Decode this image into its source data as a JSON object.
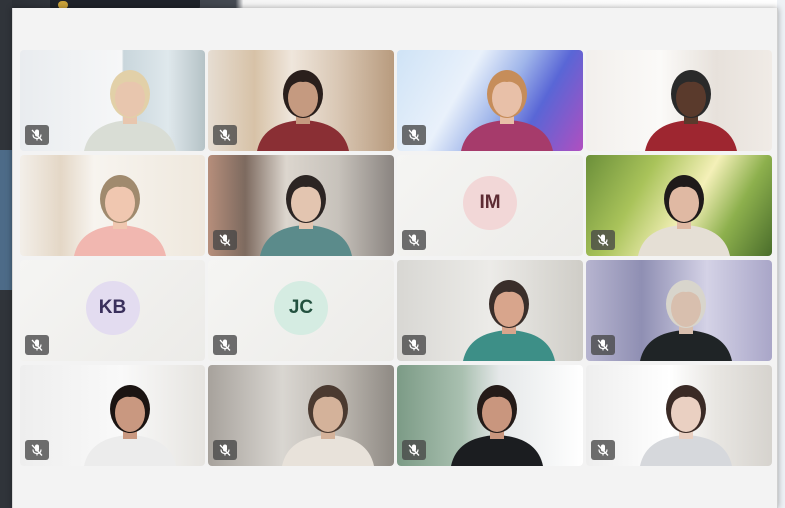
{
  "meeting": {
    "layout": "gallery-4x4",
    "participants": [
      {
        "type": "video",
        "muted": true,
        "scene": "office-window",
        "skin": "#e8c6ae",
        "hair": "#e2d0a8",
        "shirt": "#d9ddd5"
      },
      {
        "type": "video",
        "muted": true,
        "scene": "bookshelf-room",
        "skin": "#c59a80",
        "hair": "#2a1f1c",
        "shirt": "#8a2f34"
      },
      {
        "type": "video",
        "muted": true,
        "scene": "abstract-waves",
        "skin": "#e8c0a8",
        "hair": "#c68d5a",
        "shirt": "#a63b6b"
      },
      {
        "type": "video",
        "muted": false,
        "scene": "office",
        "skin": "#5a3a2c",
        "hair": "#2a2a2a",
        "shirt": "#9e2630"
      },
      {
        "type": "video",
        "muted": false,
        "scene": "kitchen",
        "skin": "#f0c7b0",
        "hair": "#a08a6e",
        "shirt": "#f1b7b0"
      },
      {
        "type": "video",
        "muted": true,
        "scene": "library",
        "skin": "#e3c5b0",
        "hair": "#2c2523",
        "shirt": "#5b8b8b"
      },
      {
        "type": "avatar",
        "muted": true,
        "initials": "IM",
        "circle_color": "#f2d7d7",
        "text_color": "#5e2b33"
      },
      {
        "type": "video",
        "muted": true,
        "scene": "sunny-garden",
        "skin": "#e0b9a3",
        "hair": "#1f1a1a",
        "shirt": "#e5dfd5"
      },
      {
        "type": "avatar",
        "muted": true,
        "initials": "KB",
        "circle_color": "#e3dcf0",
        "text_color": "#3a2f5c"
      },
      {
        "type": "avatar",
        "muted": true,
        "initials": "JC",
        "circle_color": "#d5ece2",
        "text_color": "#23513f"
      },
      {
        "type": "video",
        "muted": true,
        "scene": "plain-room",
        "skin": "#d8a58c",
        "hair": "#3a2e2a",
        "shirt": "#3d8f87"
      },
      {
        "type": "video",
        "muted": true,
        "scene": "arch-background",
        "skin": "#d8bfae",
        "hair": "#d8d5cc",
        "shirt": "#1f2426"
      },
      {
        "type": "video",
        "muted": true,
        "scene": "guitar-room",
        "skin": "#c99880",
        "hair": "#1b1412",
        "shirt": "#ececec"
      },
      {
        "type": "video",
        "muted": true,
        "scene": "dim-office",
        "skin": "#d4b29a",
        "hair": "#4b3a30",
        "shirt": "#e8e2da"
      },
      {
        "type": "video",
        "muted": true,
        "scene": "green-wall",
        "skin": "#c9967e",
        "hair": "#241b18",
        "shirt": "#1b1d20"
      },
      {
        "type": "video",
        "muted": true,
        "scene": "shelf-room",
        "skin": "#ead0c2",
        "hair": "#3a2a25",
        "shirt": "#d6d8dc"
      }
    ]
  },
  "icons": {
    "mic": "microphone-muted-icon"
  }
}
